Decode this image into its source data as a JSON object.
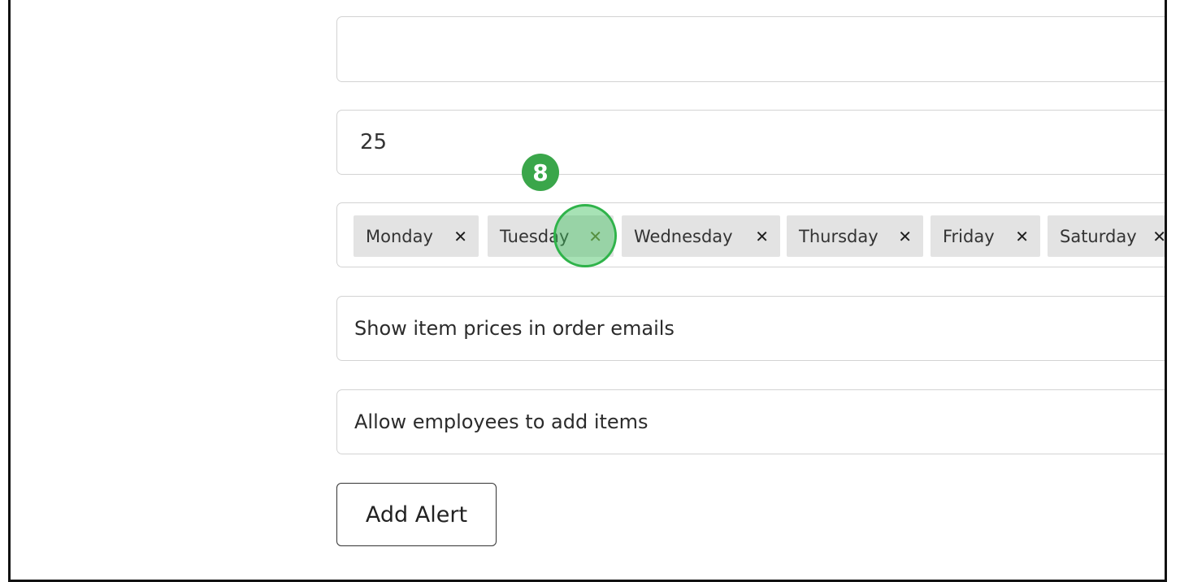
{
  "form": {
    "empty_field_value": "",
    "quantity_value": "25",
    "days": [
      {
        "label": "Monday",
        "remove": "✕"
      },
      {
        "label": "Tuesday",
        "remove": "✕"
      },
      {
        "label": "Wednesday",
        "remove": "✕"
      },
      {
        "label": "Thursday",
        "remove": "✕"
      },
      {
        "label": "Friday",
        "remove": "✕"
      },
      {
        "label": "Saturday",
        "remove": "✕"
      }
    ],
    "show_prices_label": "Show item prices in order emails",
    "allow_employees_label": "Allow employees to add items",
    "add_alert_label": "Add Alert"
  },
  "annotation": {
    "step_number": "8",
    "highlight_color": "#3aa64a"
  }
}
